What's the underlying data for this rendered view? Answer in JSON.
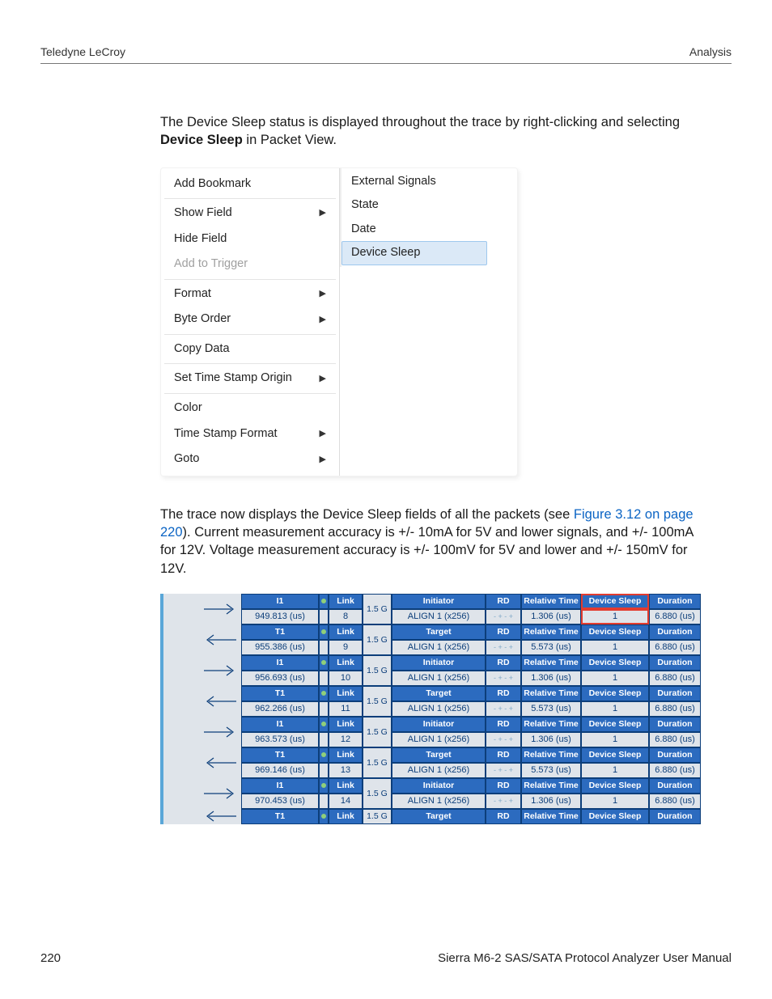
{
  "header": {
    "left": "Teledyne LeCroy",
    "right": "Analysis"
  },
  "para1": {
    "a": "The Device Sleep status is displayed throughout the trace by right-clicking and selecting ",
    "b": "Device Sleep",
    "c": " in Packet View."
  },
  "menu": {
    "items": [
      {
        "label": "Add Bookmark",
        "arrow": false,
        "disabled": false,
        "sep": true
      },
      {
        "label": "Show Field",
        "arrow": true,
        "disabled": false
      },
      {
        "label": "Hide Field",
        "arrow": false,
        "disabled": false
      },
      {
        "label": "Add to Trigger",
        "arrow": false,
        "disabled": true,
        "sep": true
      },
      {
        "label": "Format",
        "arrow": true,
        "disabled": false
      },
      {
        "label": "Byte Order",
        "arrow": true,
        "disabled": false,
        "sep": true
      },
      {
        "label": "Copy Data",
        "arrow": false,
        "disabled": false,
        "sep": true
      },
      {
        "label": "Set Time Stamp Origin",
        "arrow": true,
        "disabled": false,
        "sep": true
      },
      {
        "label": "Color",
        "arrow": false,
        "disabled": false
      },
      {
        "label": "Time Stamp Format",
        "arrow": true,
        "disabled": false
      },
      {
        "label": "Goto",
        "arrow": true,
        "disabled": false
      }
    ],
    "sub": [
      {
        "label": "External Signals"
      },
      {
        "label": "State"
      },
      {
        "label": "Date"
      },
      {
        "label": "Device Sleep",
        "hover": true
      }
    ]
  },
  "para2": {
    "a": "The trace now displays the Device Sleep fields of all the packets (see ",
    "link": "Figure 3.12 on page 220",
    "b": "). Current measurement accuracy is +/- 10mA for 5V and lower signals, and +/- 100mA for 12V. Voltage measurement accuracy is +/- 100mV for 5V and lower and +/- 150mV for 12V."
  },
  "trace": {
    "rate": "1.5 G",
    "cols": {
      "link": "Link",
      "align": "ALIGN 1  (x256)",
      "rd": "RD",
      "rt": "Relative Time",
      "ds": "Device Sleep",
      "dur": "Duration",
      "flag": "- + - +"
    },
    "rows": [
      {
        "dir": "I",
        "lab": "I1",
        "time": "949.813 (us)",
        "link": "8",
        "role": "Initiator",
        "rt": "1.306 (us)",
        "ds": "1",
        "dur": "6.880 (us)",
        "hl": true
      },
      {
        "dir": "T",
        "lab": "T1",
        "time": "955.386 (us)",
        "link": "9",
        "role": "Target",
        "rt": "5.573 (us)",
        "ds": "1",
        "dur": "6.880 (us)"
      },
      {
        "dir": "I",
        "lab": "I1",
        "time": "956.693 (us)",
        "link": "10",
        "role": "Initiator",
        "rt": "1.306 (us)",
        "ds": "1",
        "dur": "6.880 (us)"
      },
      {
        "dir": "T",
        "lab": "T1",
        "time": "962.266 (us)",
        "link": "11",
        "role": "Target",
        "rt": "5.573 (us)",
        "ds": "1",
        "dur": "6.880 (us)"
      },
      {
        "dir": "I",
        "lab": "I1",
        "time": "963.573 (us)",
        "link": "12",
        "role": "Initiator",
        "rt": "1.306 (us)",
        "ds": "1",
        "dur": "6.880 (us)"
      },
      {
        "dir": "T",
        "lab": "T1",
        "time": "969.146 (us)",
        "link": "13",
        "role": "Target",
        "rt": "5.573 (us)",
        "ds": "1",
        "dur": "6.880 (us)"
      },
      {
        "dir": "I",
        "lab": "I1",
        "time": "970.453 (us)",
        "link": "14",
        "role": "Initiator",
        "rt": "1.306 (us)",
        "ds": "1",
        "dur": "6.880 (us)"
      },
      {
        "dir": "T",
        "lab": "T1",
        "time": "",
        "link": "",
        "role": "Target",
        "rt": "",
        "ds": "",
        "dur": "",
        "half": true
      }
    ]
  },
  "footer": {
    "page": "220",
    "title": "Sierra M6-2 SAS/SATA Protocol Analyzer User Manual"
  }
}
